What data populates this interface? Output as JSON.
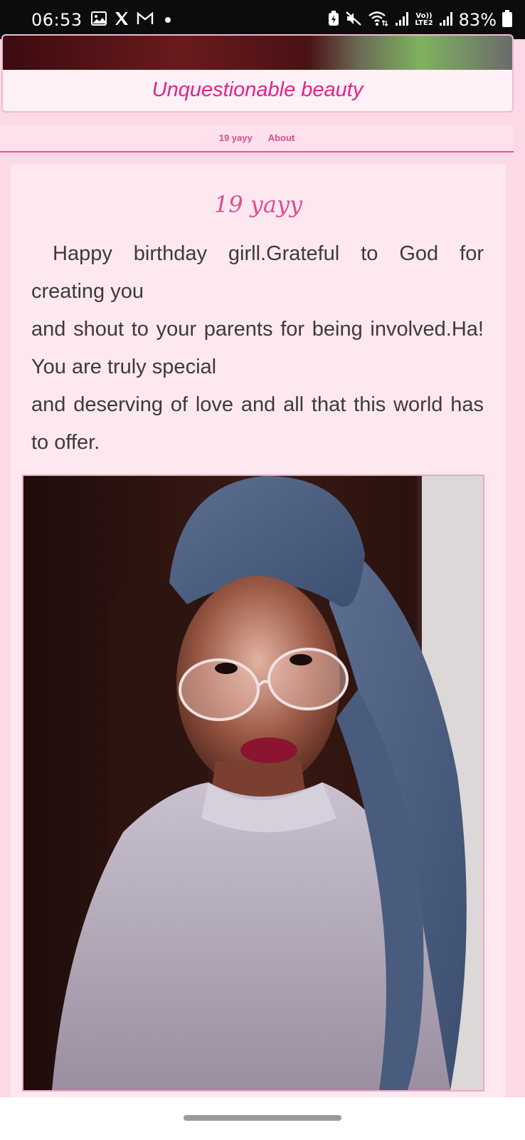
{
  "status_bar": {
    "time": "06:53",
    "battery_percent": "83%",
    "network_label_top": "Vo))",
    "network_label_bottom": "LTE2",
    "left_icons": [
      "gallery-icon",
      "x-icon",
      "gmail-icon",
      "notification-dot-icon"
    ],
    "right_icons": [
      "battery-saver-icon",
      "mute-icon",
      "wifi-icon",
      "signal-icon",
      "signal-icon",
      "battery-icon"
    ]
  },
  "header": {
    "title": "Unquestionable beauty"
  },
  "tabs": [
    {
      "label": "19 yayy"
    },
    {
      "label": "About"
    }
  ],
  "post": {
    "title": "19 yayy",
    "paragraphs": [
      "Happy birthday girll.Grateful to God for creating you",
      "and shout to your parents for being involved.Ha! You are truly special",
      "and deserving of love and all that this world has to offer."
    ]
  },
  "colors": {
    "accent": "#e0248a",
    "page_background": "#fbd9e6",
    "card_background": "#fde8ef",
    "tab_underline": "#e5559b"
  }
}
